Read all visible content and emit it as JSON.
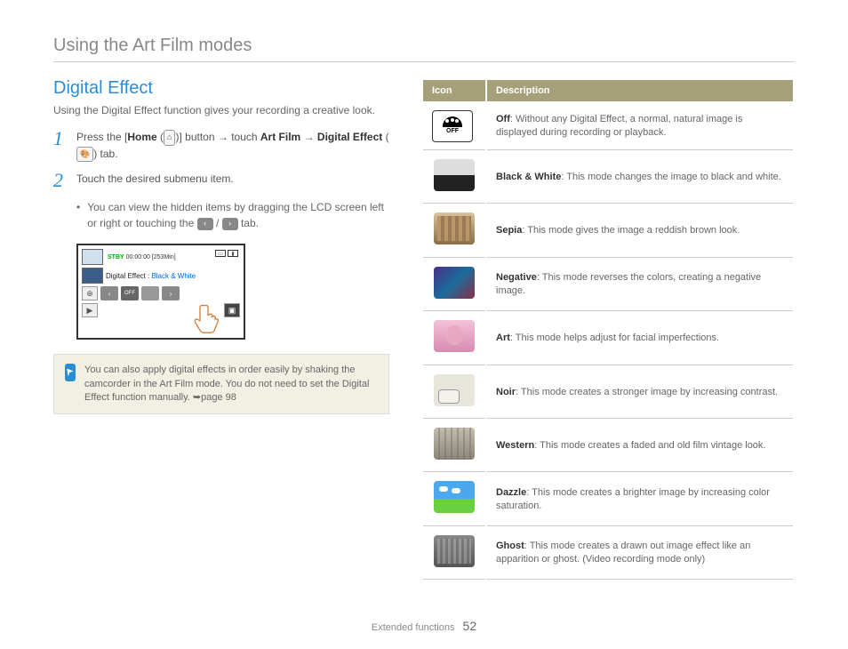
{
  "page_title": "Using the Art Film modes",
  "section_title": "Digital Effect",
  "intro": "Using the Digital Effect function gives your recording a creative look.",
  "steps": {
    "s1": {
      "num": "1",
      "p1": "Press the [",
      "home": "Home",
      "p2": " (",
      "p3": ")] button ",
      "arrow1": "→",
      "p4": " touch ",
      "artfilm": "Art Film",
      "arrow2": " → ",
      "de": "Digital Effect",
      "p5": " (",
      "p6": ") tab."
    },
    "s2": {
      "num": "2",
      "text": "Touch the desired submenu item."
    }
  },
  "bullet": {
    "p1": "You can view the hidden items by dragging the LCD screen left or right or touching the ",
    "p2": " / ",
    "p3": " tab."
  },
  "lcd": {
    "stby": "STBY",
    "time": "00:00:00 [253Min]",
    "label_pre": "Digital Effect : ",
    "label_mode": "Black & White",
    "off": "OFF"
  },
  "note": "You can also apply digital effects in order easily by shaking the camcorder in the Art Film mode. You do not need to set the Digital Effect function manually. ➥page 98",
  "table": {
    "h_icon": "Icon",
    "h_desc": "Description",
    "rows": [
      {
        "name": "Off",
        "off_label": "OFF",
        "desc": ": Without any Digital Effect, a normal, natural image is displayed during recording or playback."
      },
      {
        "name": "Black & White",
        "desc": ": This mode changes the image to black and white."
      },
      {
        "name": "Sepia",
        "desc": ": This mode gives the image a reddish brown look."
      },
      {
        "name": "Negative",
        "desc": ": This mode reverses the colors, creating a negative image."
      },
      {
        "name": "Art",
        "desc": ": This mode helps adjust for facial imperfections."
      },
      {
        "name": "Noir",
        "desc": ": This mode creates a stronger image by increasing contrast."
      },
      {
        "name": "Western",
        "desc": ": This mode creates a faded and old film vintage look."
      },
      {
        "name": "Dazzle",
        "desc": ": This mode creates a brighter image by increasing color saturation."
      },
      {
        "name": "Ghost",
        "desc": ": This mode creates a drawn out image effect like an apparition or ghost. (Video recording mode only)"
      }
    ]
  },
  "footer": {
    "section": "Extended functions",
    "page": "52"
  }
}
